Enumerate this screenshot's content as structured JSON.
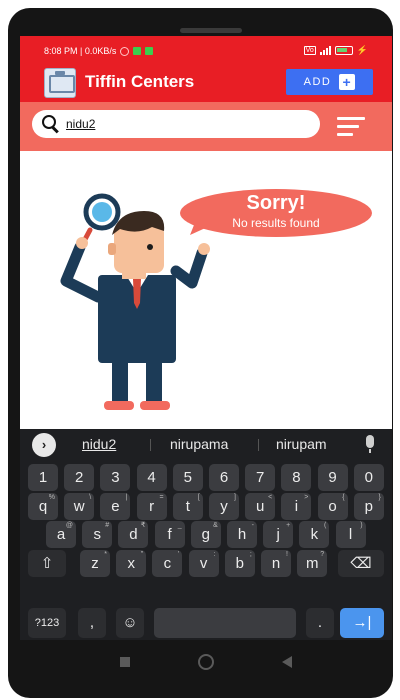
{
  "status_bar": {
    "time_speed": "8:08 PM | 0.0KB/s",
    "battery": "65"
  },
  "header": {
    "title": "Tiffin Centers",
    "add_button_label": "ADD",
    "add_button_icon": "plus-box-icon",
    "brand_color": "#e81e25",
    "search_bar_color": "#f26a5e",
    "accent_color": "#3d6ff2"
  },
  "search": {
    "query": "nidu2",
    "icon": "search-icon"
  },
  "empty_state": {
    "title": "Sorry!",
    "message": "No results found"
  },
  "keyboard": {
    "suggestions": [
      "nidu2",
      "nirupama",
      "nirupam"
    ],
    "number_row": [
      "1",
      "2",
      "3",
      "4",
      "5",
      "6",
      "7",
      "8",
      "9",
      "0"
    ],
    "row1": [
      {
        "k": "q",
        "s": "%"
      },
      {
        "k": "w",
        "s": "\\"
      },
      {
        "k": "e",
        "s": "|"
      },
      {
        "k": "r",
        "s": "="
      },
      {
        "k": "t",
        "s": "["
      },
      {
        "k": "y",
        "s": "]"
      },
      {
        "k": "u",
        "s": "<"
      },
      {
        "k": "i",
        "s": ">"
      },
      {
        "k": "o",
        "s": "{"
      },
      {
        "k": "p",
        "s": "}"
      }
    ],
    "row2": [
      {
        "k": "a",
        "s": "@"
      },
      {
        "k": "s",
        "s": "#"
      },
      {
        "k": "d",
        "s": "₹"
      },
      {
        "k": "f",
        "s": "_"
      },
      {
        "k": "g",
        "s": "&"
      },
      {
        "k": "h",
        "s": "-"
      },
      {
        "k": "j",
        "s": "+"
      },
      {
        "k": "k",
        "s": "("
      },
      {
        "k": "l",
        "s": ")"
      }
    ],
    "row3": [
      {
        "k": "z",
        "s": "*"
      },
      {
        "k": "x",
        "s": "\""
      },
      {
        "k": "c",
        "s": "'"
      },
      {
        "k": "v",
        "s": ":"
      },
      {
        "k": "b",
        "s": ";"
      },
      {
        "k": "n",
        "s": "!"
      },
      {
        "k": "m",
        "s": "?"
      }
    ],
    "symbols_label": "?123",
    "comma": ",",
    "period": ".",
    "emoji_icon": "emoji-icon",
    "enter_icon": "enter-arrow-icon",
    "shift_icon": "shift-icon",
    "backspace_icon": "backspace-icon"
  }
}
